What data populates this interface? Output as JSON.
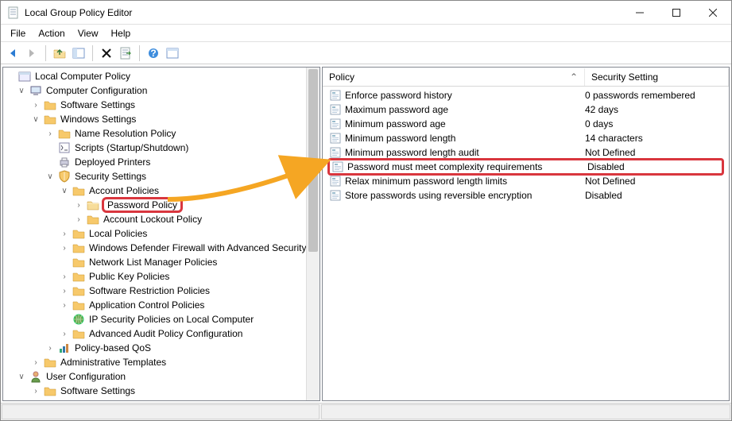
{
  "title": "Local Group Policy Editor",
  "menu": {
    "file": "File",
    "action": "Action",
    "view": "View",
    "help": "Help"
  },
  "tree_root": "Local Computer Policy",
  "tree": {
    "computer_config": "Computer Configuration",
    "software_settings": "Software Settings",
    "windows_settings": "Windows Settings",
    "name_res": "Name Resolution Policy",
    "scripts": "Scripts (Startup/Shutdown)",
    "deployed_printers": "Deployed Printers",
    "security_settings": "Security Settings",
    "account_policies": "Account Policies",
    "password_policy": "Password Policy",
    "account_lockout": "Account Lockout Policy",
    "local_policies": "Local Policies",
    "wdf": "Windows Defender Firewall with Advanced Security",
    "nlm": "Network List Manager Policies",
    "pkp": "Public Key Policies",
    "srp": "Software Restriction Policies",
    "acp": "Application Control Policies",
    "ips": "IP Security Policies on Local Computer",
    "aapc": "Advanced Audit Policy Configuration",
    "pbqos": "Policy-based QoS",
    "admin_templates": "Administrative Templates",
    "user_config": "User Configuration",
    "u_software": "Software Settings"
  },
  "cols": {
    "policy": "Policy",
    "setting": "Security Setting"
  },
  "rows": [
    {
      "p": "Enforce password history",
      "s": "0 passwords remembered"
    },
    {
      "p": "Maximum password age",
      "s": "42 days"
    },
    {
      "p": "Minimum password age",
      "s": "0 days"
    },
    {
      "p": "Minimum password length",
      "s": "14 characters"
    },
    {
      "p": "Minimum password length audit",
      "s": "Not Defined"
    },
    {
      "p": "Password must meet complexity requirements",
      "s": "Disabled"
    },
    {
      "p": "Relax minimum password length limits",
      "s": "Not Defined"
    },
    {
      "p": "Store passwords using reversible encryption",
      "s": "Disabled"
    }
  ]
}
